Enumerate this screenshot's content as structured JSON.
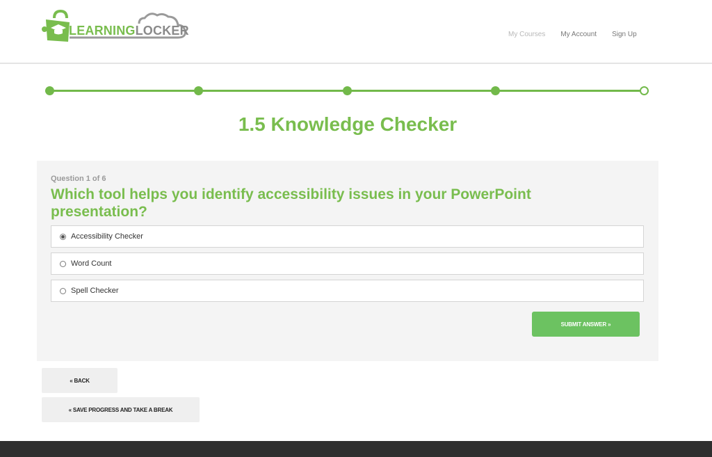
{
  "brand": {
    "learning": "LEARNING",
    "locker": "LOCKER",
    "green": "#79bd4e",
    "gray": "#8a8a8a"
  },
  "nav": {
    "my_courses": "My Courses",
    "my_account": "My Account",
    "sign_up": "Sign Up"
  },
  "progress": {
    "steps_total": 5,
    "steps_completed": 4,
    "color": "#72b94a"
  },
  "page": {
    "title": "1.5 Knowledge Checker"
  },
  "quiz": {
    "counter": "Question 1 of 6",
    "question": "Which tool helps you identify accessibility issues in your PowerPoint presentation?",
    "options": [
      {
        "label": "Accessibility Checker",
        "selected": true
      },
      {
        "label": "Word Count",
        "selected": false
      },
      {
        "label": "Spell Checker",
        "selected": false
      }
    ],
    "submit_label": "SUBMIT ANSWER »",
    "submit_color": "#6cc261"
  },
  "actions": {
    "back_label": "« BACK",
    "save_label": "« SAVE PROGRESS AND TAKE A BREAK"
  }
}
